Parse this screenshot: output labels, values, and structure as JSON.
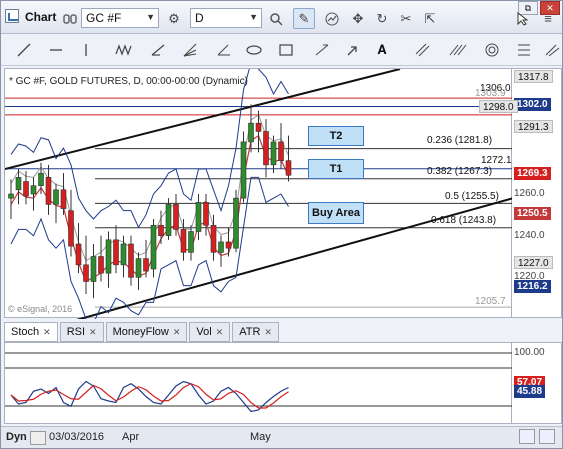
{
  "app": {
    "title": "Chart"
  },
  "toolbar": {
    "symbol": "GC #F",
    "interval": "D"
  },
  "window_controls": {
    "restore": "⧉",
    "close": "✕"
  },
  "chart": {
    "info": "* GC #F, GOLD FUTURES, D, 00:00-00:00 (Dynamic)",
    "copyright": "© eSignal, 2016",
    "low_label": "1205.7",
    "fibs": [
      {
        "label": "0.236 (1281.8)"
      },
      {
        "label": "0.382 (1267.3)"
      },
      {
        "label": "0.5 (1255.5)"
      },
      {
        "label": "0.618 (1243.8)"
      }
    ],
    "zones": {
      "t2": "T2",
      "t1": "T1",
      "buy": "Buy Area"
    },
    "top_labels": {
      "high": "1306.0",
      "high2": "1303.9",
      "mid": "1272.1"
    }
  },
  "price_axis": {
    "labels": [
      "1317.8",
      "1291.3",
      "1260.0",
      "1240.0",
      "1220.0"
    ],
    "tags": [
      {
        "text": "1302.0",
        "color": "#ffffff",
        "bg": "#1e3a8a"
      },
      {
        "text": "1298.0",
        "color": "#111111",
        "bg": "#e5e5e5"
      },
      {
        "text": "1269.3",
        "color": "#ffffff",
        "bg": "#d62020"
      },
      {
        "text": "1250.5",
        "color": "#ffffff",
        "bg": "#c43a3a"
      },
      {
        "text": "1227.0",
        "color": "#111111",
        "bg": "#e5e5e5"
      },
      {
        "text": "1216.2",
        "color": "#ffffff",
        "bg": "#1e3a8a"
      }
    ]
  },
  "indicator_tabs": [
    "Stoch",
    "RSI",
    "MoneyFlow",
    "Vol",
    "ATR"
  ],
  "indicator_axis": {
    "top": "100.00",
    "tag1": "57.07",
    "tag2": "45.88"
  },
  "bottom": {
    "mode": "Dyn",
    "date": "03/03/2016",
    "months": [
      "Apr",
      "May"
    ]
  },
  "colors": {
    "up": "#2e8b2e",
    "down": "#d62020",
    "channel": "#111111",
    "band": "#1e3a8a"
  },
  "chart_data": {
    "type": "candlestick",
    "symbol": "GC #F",
    "ylim": [
      1200,
      1320
    ],
    "candles": [
      {
        "o": 1258,
        "h": 1267,
        "l": 1248,
        "c": 1260
      },
      {
        "o": 1262,
        "h": 1272,
        "l": 1255,
        "c": 1268
      },
      {
        "o": 1266,
        "h": 1271,
        "l": 1255,
        "c": 1259
      },
      {
        "o": 1260,
        "h": 1268,
        "l": 1252,
        "c": 1264
      },
      {
        "o": 1264,
        "h": 1275,
        "l": 1260,
        "c": 1270
      },
      {
        "o": 1268,
        "h": 1274,
        "l": 1250,
        "c": 1255
      },
      {
        "o": 1255,
        "h": 1265,
        "l": 1246,
        "c": 1262
      },
      {
        "o": 1262,
        "h": 1270,
        "l": 1250,
        "c": 1253
      },
      {
        "o": 1252,
        "h": 1262,
        "l": 1230,
        "c": 1235
      },
      {
        "o": 1236,
        "h": 1246,
        "l": 1222,
        "c": 1226
      },
      {
        "o": 1226,
        "h": 1240,
        "l": 1212,
        "c": 1218
      },
      {
        "o": 1218,
        "h": 1236,
        "l": 1210,
        "c": 1230
      },
      {
        "o": 1230,
        "h": 1240,
        "l": 1218,
        "c": 1222
      },
      {
        "o": 1222,
        "h": 1242,
        "l": 1215,
        "c": 1238
      },
      {
        "o": 1238,
        "h": 1245,
        "l": 1222,
        "c": 1226
      },
      {
        "o": 1226,
        "h": 1240,
        "l": 1220,
        "c": 1236
      },
      {
        "o": 1236,
        "h": 1240,
        "l": 1216,
        "c": 1220
      },
      {
        "o": 1220,
        "h": 1232,
        "l": 1214,
        "c": 1229
      },
      {
        "o": 1229,
        "h": 1238,
        "l": 1220,
        "c": 1223
      },
      {
        "o": 1224,
        "h": 1248,
        "l": 1220,
        "c": 1245
      },
      {
        "o": 1245,
        "h": 1252,
        "l": 1236,
        "c": 1240
      },
      {
        "o": 1240,
        "h": 1258,
        "l": 1238,
        "c": 1255
      },
      {
        "o": 1255,
        "h": 1260,
        "l": 1240,
        "c": 1243
      },
      {
        "o": 1243,
        "h": 1248,
        "l": 1228,
        "c": 1232
      },
      {
        "o": 1232,
        "h": 1245,
        "l": 1228,
        "c": 1242
      },
      {
        "o": 1242,
        "h": 1260,
        "l": 1238,
        "c": 1256
      },
      {
        "o": 1256,
        "h": 1260,
        "l": 1240,
        "c": 1245
      },
      {
        "o": 1245,
        "h": 1250,
        "l": 1228,
        "c": 1232
      },
      {
        "o": 1232,
        "h": 1240,
        "l": 1225,
        "c": 1237
      },
      {
        "o": 1237,
        "h": 1244,
        "l": 1230,
        "c": 1234
      },
      {
        "o": 1234,
        "h": 1262,
        "l": 1232,
        "c": 1258
      },
      {
        "o": 1258,
        "h": 1290,
        "l": 1256,
        "c": 1285
      },
      {
        "o": 1285,
        "h": 1303,
        "l": 1280,
        "c": 1294
      },
      {
        "o": 1294,
        "h": 1300,
        "l": 1280,
        "c": 1290
      },
      {
        "o": 1290,
        "h": 1296,
        "l": 1268,
        "c": 1274
      },
      {
        "o": 1274,
        "h": 1288,
        "l": 1270,
        "c": 1285
      },
      {
        "o": 1285,
        "h": 1294,
        "l": 1272,
        "c": 1276
      },
      {
        "o": 1276,
        "h": 1288,
        "l": 1266,
        "c": 1269
      }
    ]
  }
}
